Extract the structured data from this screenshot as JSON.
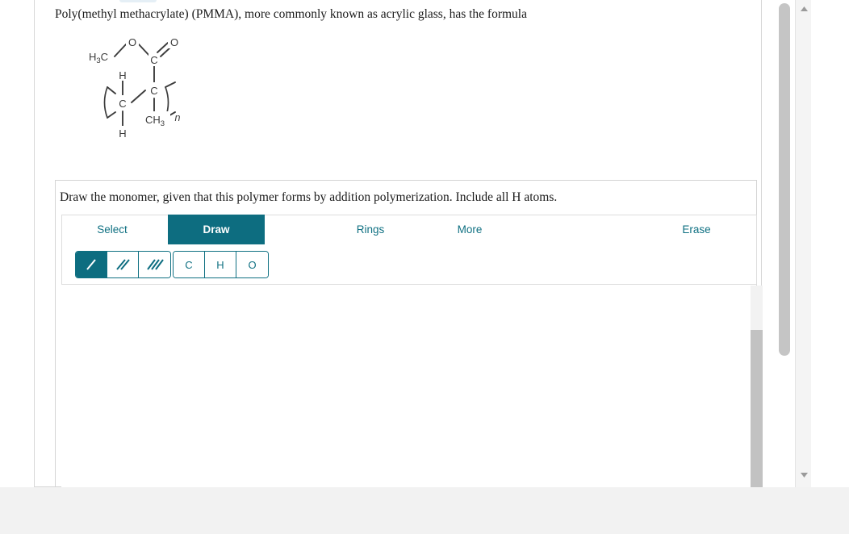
{
  "question": {
    "stem": "Poly(methyl methacrylate) (PMMA), more commonly known as acrylic glass, has the formula",
    "instruction": "Draw the monomer, given that this polymer forms by addition polymerization. Include all H atoms."
  },
  "structure": {
    "name": "pmma-repeat-unit",
    "labels": {
      "methyl_ester": "H3C",
      "ester_oxygen": "O",
      "carbonyl_oxygen": "O",
      "carbonyl_carbon": "C",
      "backbone_carbon_quaternary": "C",
      "backbone_carbon_ch2": "C",
      "h_top": "H",
      "h_bottom": "H",
      "side_methyl": "CH3",
      "repeat_subscript": "n"
    }
  },
  "editor": {
    "tabs": [
      {
        "id": "select",
        "label": "Select",
        "selected": false
      },
      {
        "id": "draw",
        "label": "Draw",
        "selected": true
      },
      {
        "id": "rings",
        "label": "Rings",
        "selected": false
      },
      {
        "id": "more",
        "label": "More",
        "selected": false
      }
    ],
    "erase_label": "Erase",
    "bond_tools": [
      {
        "id": "single-bond",
        "icon": "single-bond-icon",
        "selected": true
      },
      {
        "id": "double-bond",
        "icon": "double-bond-icon",
        "selected": false
      },
      {
        "id": "triple-bond",
        "icon": "triple-bond-icon",
        "selected": false
      }
    ],
    "atom_tools": [
      {
        "id": "carbon",
        "label": "C",
        "selected": false
      },
      {
        "id": "hydrogen",
        "label": "H",
        "selected": false
      },
      {
        "id": "oxygen",
        "label": "O",
        "selected": false
      }
    ],
    "canvas_content": ""
  },
  "colors": {
    "accent_teal": "#0d6d80",
    "accent_teal_text": "#0f7082",
    "page_background": "#f2f2f2",
    "border_grey": "#d4d4d4",
    "scrollbar_thumb": "#c2c2c2"
  }
}
